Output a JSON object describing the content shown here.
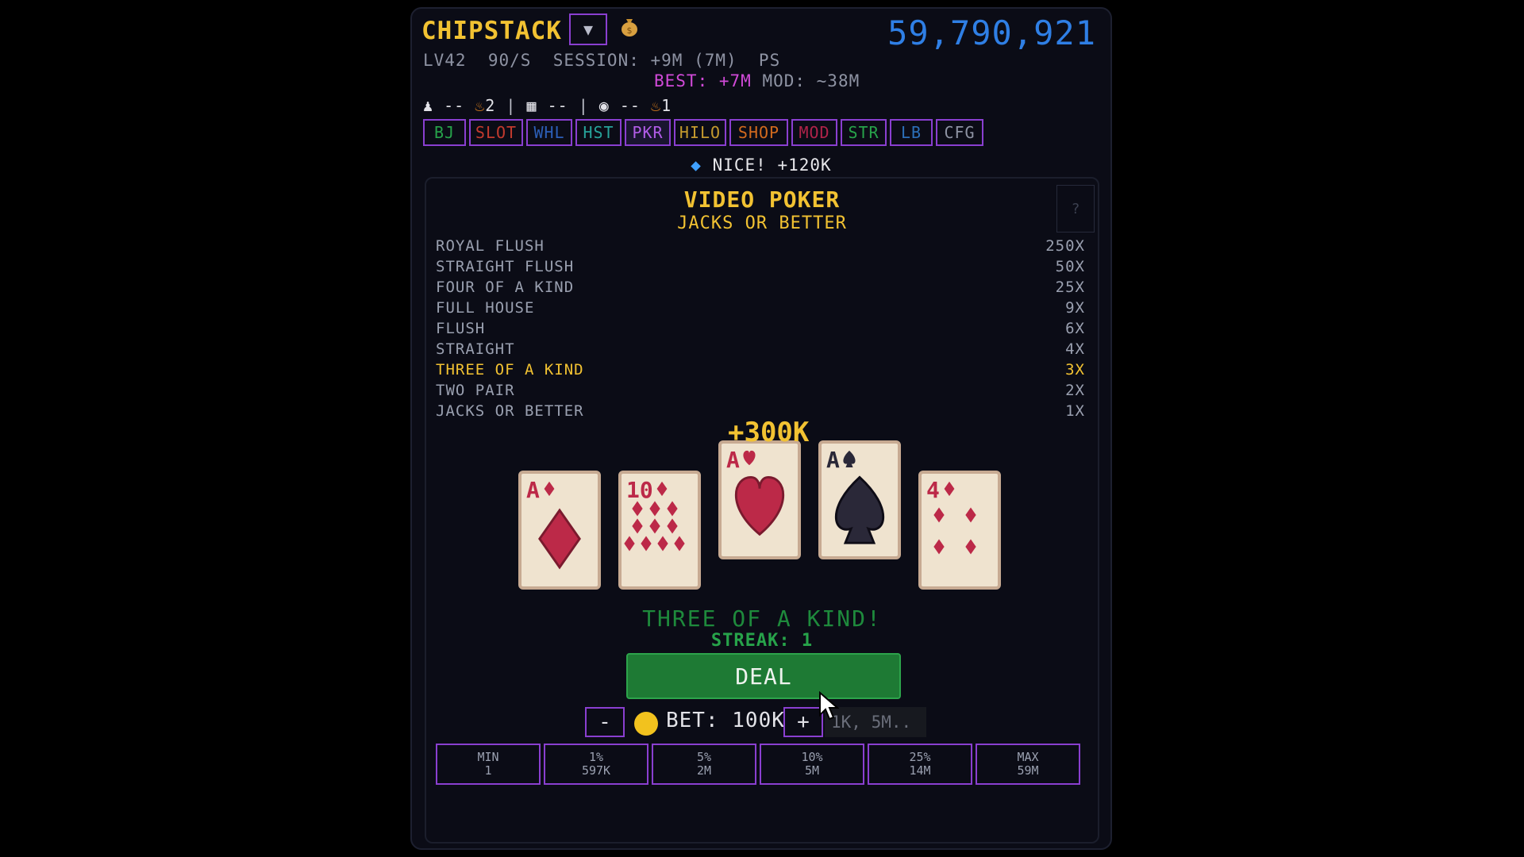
{
  "header": {
    "title": "CHIPSTACK",
    "dropdown_glyph": "▼",
    "bag_icon": "money-bag-icon",
    "balance": "59,790,921",
    "stat_line": "LV42  90/S  SESSION: +9M (7M)  PS",
    "best": "BEST: +7M",
    "mod": "MOD: ~38M",
    "icon_row": {
      "a": "--",
      "a_fire": "2",
      "b": "--",
      "c": "--",
      "c_fire": "1"
    }
  },
  "tabs": [
    {
      "label": "BJ",
      "color": "#27a34a",
      "active": false
    },
    {
      "label": "SLOT",
      "color": "#c23a2e",
      "active": false
    },
    {
      "label": "WHL",
      "color": "#2c5fb8",
      "active": false
    },
    {
      "label": "HST",
      "color": "#27a39a",
      "active": false
    },
    {
      "label": "PKR",
      "color": "#b25ce8",
      "active": true
    },
    {
      "label": "HILO",
      "color": "#c49a2e",
      "active": false
    },
    {
      "label": "SHOP",
      "color": "#d16a1e",
      "active": false
    },
    {
      "label": "MOD",
      "color": "#b0234a",
      "active": false
    },
    {
      "label": "STR",
      "color": "#27a34a",
      "active": false
    },
    {
      "label": "LB",
      "color": "#2c6fb8",
      "active": false
    },
    {
      "label": "CFG",
      "color": "#8e93a3",
      "active": false
    }
  ],
  "notice": "NICE! +120K",
  "game": {
    "title": "VIDEO POKER",
    "subtitle": "JACKS OR BETTER",
    "help": "?",
    "paytable": [
      {
        "hand": "ROYAL FLUSH",
        "payout": "250X",
        "highlight": false
      },
      {
        "hand": "STRAIGHT FLUSH",
        "payout": "50X",
        "highlight": false
      },
      {
        "hand": "FOUR OF A KIND",
        "payout": "25X",
        "highlight": false
      },
      {
        "hand": "FULL HOUSE",
        "payout": "9X",
        "highlight": false
      },
      {
        "hand": "FLUSH",
        "payout": "6X",
        "highlight": false
      },
      {
        "hand": "STRAIGHT",
        "payout": "4X",
        "highlight": false
      },
      {
        "hand": "THREE OF A KIND",
        "payout": "3X",
        "highlight": true
      },
      {
        "hand": "TWO PAIR",
        "payout": "2X",
        "highlight": false
      },
      {
        "hand": "JACKS OR BETTER",
        "payout": "1X",
        "highlight": false
      }
    ],
    "win_amount": "+300K",
    "cards": [
      {
        "rank": "A",
        "suit": "diamond",
        "held": false
      },
      {
        "rank": "10",
        "suit": "diamond",
        "held": false
      },
      {
        "rank": "A",
        "suit": "heart",
        "held": true
      },
      {
        "rank": "A",
        "suit": "spade",
        "held": true
      },
      {
        "rank": "4",
        "suit": "diamond",
        "held": false
      }
    ],
    "result": "THREE OF A KIND!",
    "streak": "STREAK: 1",
    "deal_label": "DEAL",
    "minus_label": "-",
    "plus_label": "+",
    "bet": "BET: 100K",
    "bet_placeholder": "1K, 5M..",
    "bet_buttons": [
      {
        "top": "MIN",
        "bottom": "1"
      },
      {
        "top": "1%",
        "bottom": "597K"
      },
      {
        "top": "5%",
        "bottom": "2M"
      },
      {
        "top": "10%",
        "bottom": "5M"
      },
      {
        "top": "25%",
        "bottom": "14M"
      },
      {
        "top": "MAX",
        "bottom": "59M"
      }
    ]
  },
  "colors": {
    "accent_purple": "#8a3fd0",
    "gold": "#f2c232",
    "balance_blue": "#2f7fe5",
    "deal_green": "#1e7a34",
    "card_red": "#bc2948",
    "card_black": "#2a2838"
  }
}
